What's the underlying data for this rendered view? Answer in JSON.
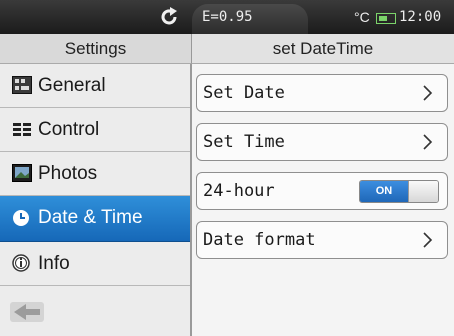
{
  "statusbar": {
    "icon": "refresh-icon",
    "emissivity": "E=0.95",
    "unit": "°C",
    "battery_icon": "battery-icon",
    "battery_level": 0.6,
    "time": "12:00"
  },
  "sidebar": {
    "title": "Settings",
    "items": [
      {
        "label": "General",
        "icon": "general-icon",
        "active": false
      },
      {
        "label": "Control",
        "icon": "control-icon",
        "active": false
      },
      {
        "label": "Photos",
        "icon": "photos-icon",
        "active": false
      },
      {
        "label": "Date & Time",
        "icon": "clock-icon",
        "active": true
      },
      {
        "label": "Info",
        "icon": "info-icon",
        "active": false
      }
    ],
    "back_icon": "back-arrow-icon"
  },
  "panel": {
    "title": "set DateTime",
    "rows": [
      {
        "label": "Set Date",
        "type": "link"
      },
      {
        "label": "Set Time",
        "type": "link"
      },
      {
        "label": "24-hour",
        "type": "toggle",
        "value": "ON"
      },
      {
        "label": "Date format",
        "type": "link"
      }
    ]
  },
  "colors": {
    "accent": "#1e78c8",
    "statusbar": "#262626",
    "battery": "#7bd36a"
  }
}
